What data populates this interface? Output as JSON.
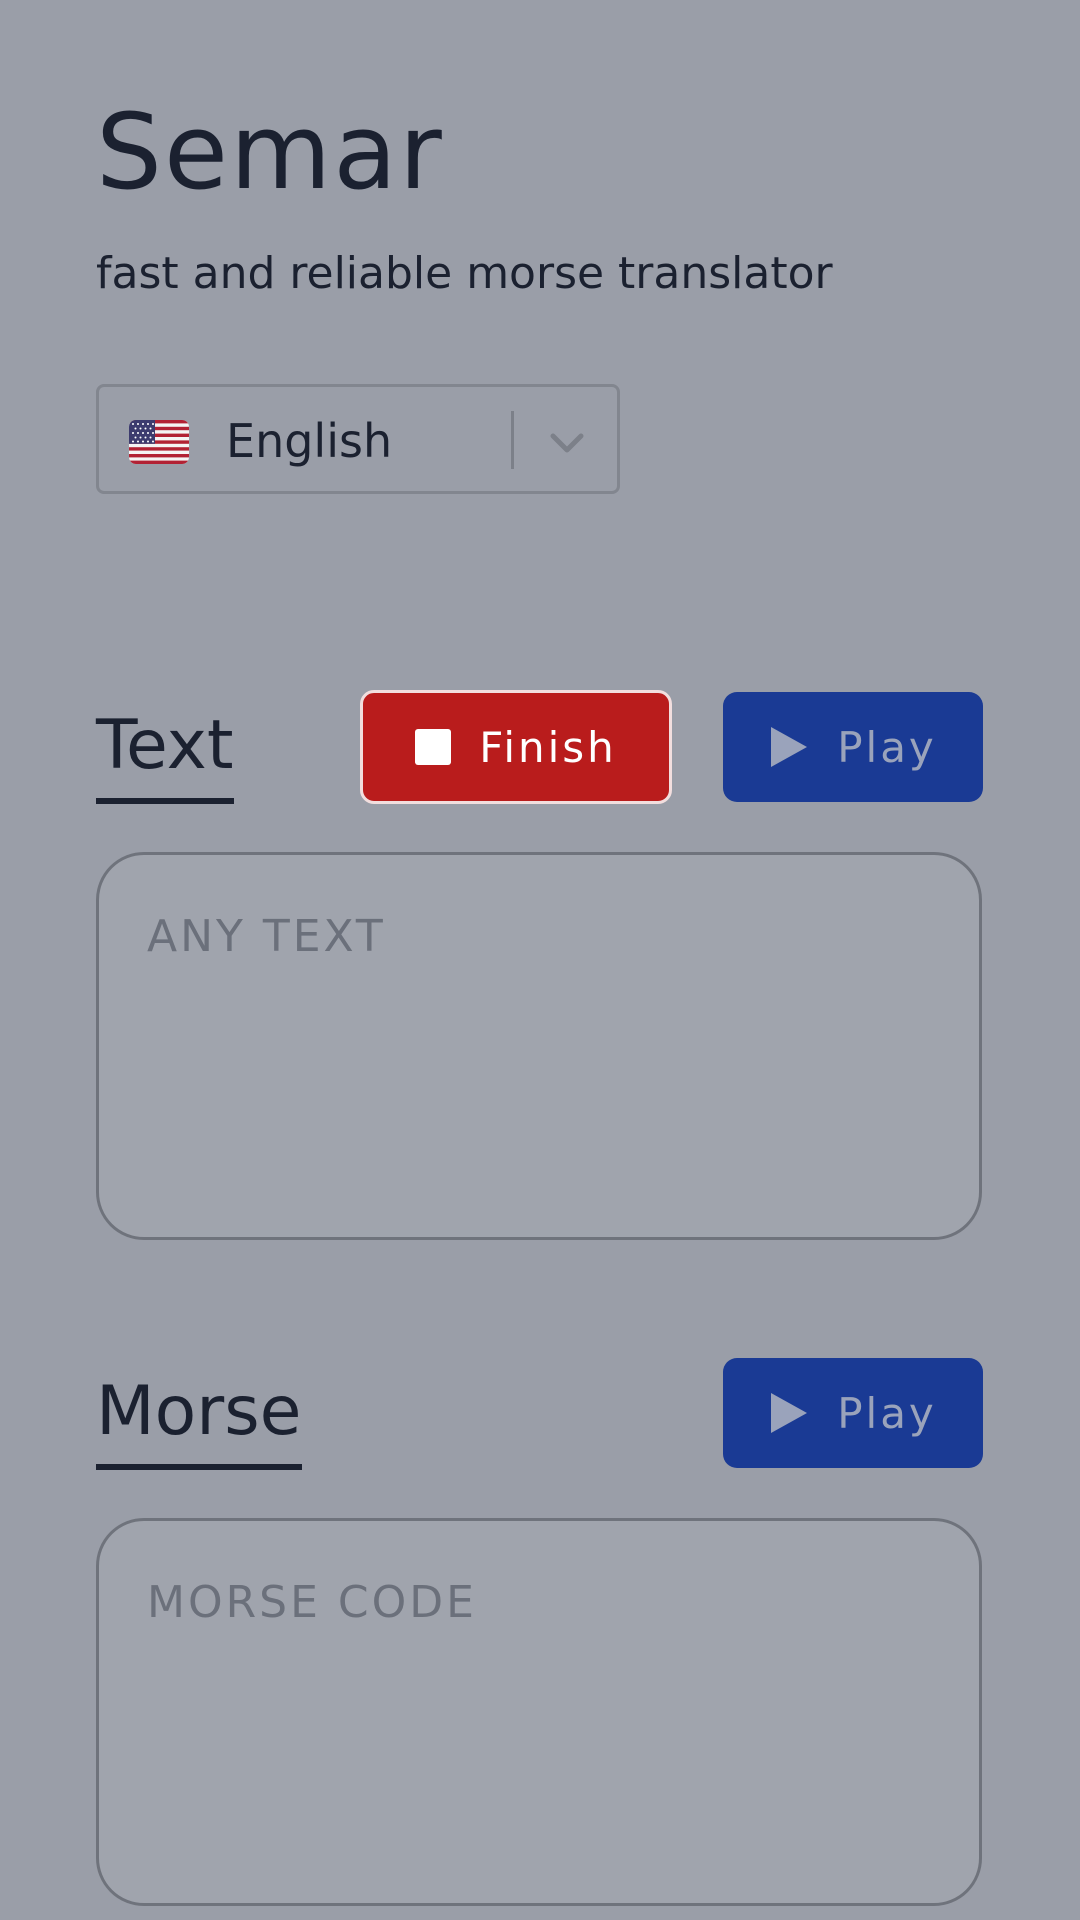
{
  "app": {
    "title": "Semar",
    "subtitle": "fast and reliable morse translator"
  },
  "language_select": {
    "selected": "English",
    "flag_icon": "us-flag-icon",
    "chevron_icon": "chevron-down-icon"
  },
  "text_section": {
    "heading": "Text",
    "finish_label": "Finish",
    "play_label": "Play",
    "placeholder": "ANY TEXT"
  },
  "morse_section": {
    "heading": "Morse",
    "play_label": "Play",
    "placeholder": "MORSE CODE"
  },
  "colors": {
    "background": "#9a9ea8",
    "finish_button": "#b91c1c",
    "play_button": "#1a3a94",
    "text": "#1b2130"
  }
}
